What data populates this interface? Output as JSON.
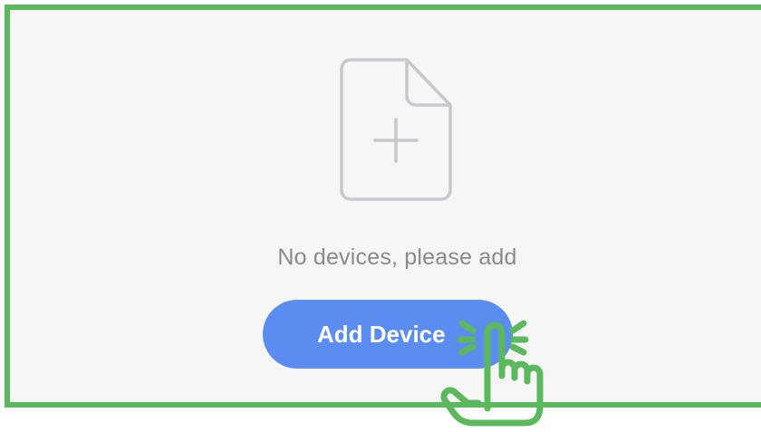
{
  "empty_state": {
    "icon": "add-file-icon",
    "message": "No devices, please add"
  },
  "actions": {
    "add_device_label": "Add Device"
  },
  "annotation": {
    "icon": "tap-hand-icon",
    "highlight_color": "#5cb85c"
  },
  "colors": {
    "button_bg": "#5b8cf0",
    "panel_bg": "#f6f6f7",
    "text_muted": "#8a8a8e"
  }
}
